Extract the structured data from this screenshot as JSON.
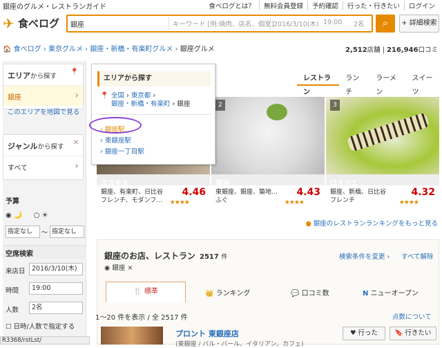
{
  "topbar": {
    "tagline": "銀座のグルメ・レストランガイド",
    "links": [
      "食べログとは？",
      "無料会員登録",
      "予約確認",
      "行った・行きたい",
      "ログイン"
    ]
  },
  "logo": {
    "text": "食べログ",
    "icon": "tabelog-wing-icon"
  },
  "search": {
    "area": "銀座",
    "keyword_placeholder": "キーワード [例:焼肉、店名、個室]",
    "date": "2016/3/10(木)",
    "time": "19:00",
    "people": "2名",
    "button_icon": "search-icon",
    "detail_label": "詳細検索"
  },
  "breadcrumb": {
    "items": [
      "食べログ",
      "東京グルメ",
      "銀座・新橋・有楽町グルメ"
    ],
    "current": "銀座グルメ"
  },
  "counts": {
    "shops": "2,512",
    "shops_label": "店舗",
    "reviews": "216,946",
    "reviews_label": "口コミ"
  },
  "left": {
    "area_title": "エリア",
    "area_suffix": "から探す",
    "area_value": "銀座",
    "map_link": "このエリアを地図で見る",
    "genre_title": "ジャンル",
    "genre_suffix": "から探す",
    "genre_value": "すべて",
    "budget_title": "予算",
    "budget_from": "指定なし",
    "budget_sep": "〜",
    "budget_to": "指定なし",
    "vacancy_title": "空席検索",
    "date_label": "来店日",
    "date_value": "2016/3/10(木)",
    "time_label": "時間",
    "time_value": "19:00",
    "people_label": "人数",
    "people_value": "2名",
    "nodate_label": "日時/人数で指定する",
    "status_url": "R3368/rstLst/"
  },
  "popup": {
    "title": "エリアから探す",
    "path1": "全国",
    "path2": "東京都",
    "path3": "銀座・新橋・有楽町",
    "path_current": "銀座",
    "stations": [
      "銀座駅",
      "東銀座駅",
      "銀座一丁目駅"
    ]
  },
  "tabs": [
    "レストラン",
    "ランチ",
    "ラーメン",
    "スイーツ"
  ],
  "cards": [
    {
      "rank": "",
      "name": "エスキス",
      "areas": "銀座、有楽町、日比谷",
      "genre": "フレンチ、モダンフ…",
      "score": "4.46",
      "stars": "★★★★"
    },
    {
      "rank": "2",
      "name": "福治",
      "areas": "東銀座、銀座、築地…",
      "genre": "ふぐ",
      "score": "4.43",
      "stars": "★★★★"
    },
    {
      "rank": "3",
      "name": "ロオジエ",
      "areas": "銀座、新橋、日比谷",
      "genre": "フレンチ",
      "score": "4.32",
      "stars": "★★★★"
    }
  ],
  "ranking_link": "銀座のレストランランキングをもっと見る",
  "results": {
    "title": "銀座のお店、レストラン",
    "count": "2517",
    "count_unit": "件",
    "change_cond": "検索条件を変更",
    "clear_all": "すべて解除",
    "tag": "銀座",
    "sort_tabs": [
      "標準",
      "ランキング",
      "口コミ数",
      "ニューオープン"
    ],
    "showing": "1〜20 件を表示 / 全 2517 件",
    "about_points": "点数について"
  },
  "first": {
    "name": "プロント 東銀座店",
    "sub": "(東銀座 / バル・バール、イタリアン、カフェ)",
    "went": "行った",
    "want": "行きたい"
  }
}
